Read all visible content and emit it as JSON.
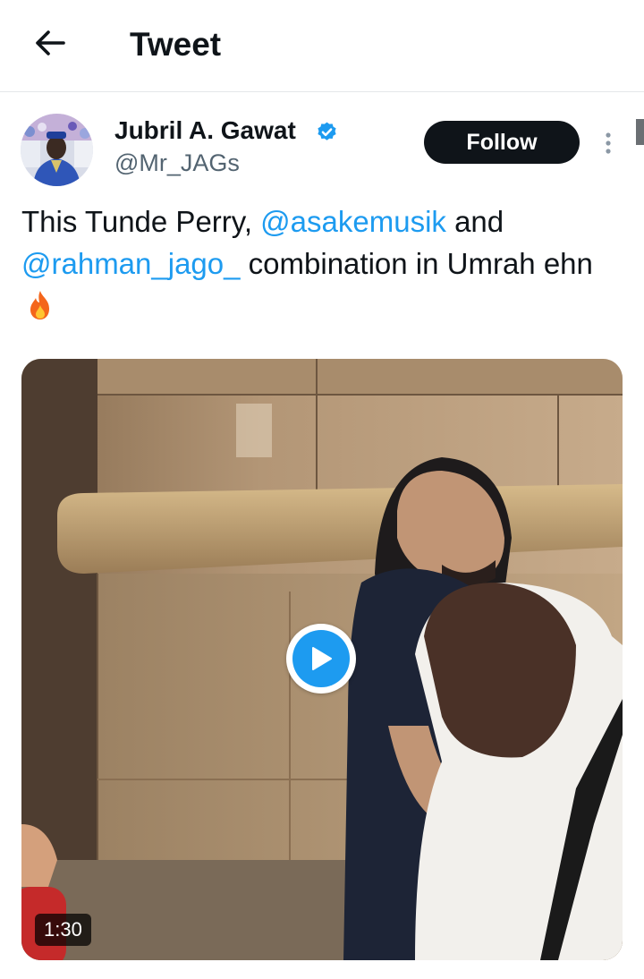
{
  "header": {
    "title": "Tweet",
    "back_icon": "arrow-left-icon"
  },
  "tweet": {
    "author": {
      "name": "Jubril A. Gawat",
      "handle": "@Mr_JAGs",
      "verified": true,
      "verified_icon": "verified-badge-icon"
    },
    "follow_label": "Follow",
    "more_icon": "more-vertical-icon",
    "text": {
      "part1": "This Tunde Perry, ",
      "mention1": "@asakemusik",
      "part2": " and ",
      "mention2": "@rahman_jago_",
      "part3": " combination in Umrah ehn",
      "emoji": "fire-emoji-icon"
    },
    "media": {
      "type": "video",
      "duration": "1:30",
      "play_icon": "play-icon"
    }
  },
  "colors": {
    "text": "#0f1419",
    "secondary_text": "#536471",
    "link": "#1d9bf0",
    "follow_bg": "#0f1419",
    "follow_text": "#ffffff",
    "divider": "#e4e7ea"
  }
}
